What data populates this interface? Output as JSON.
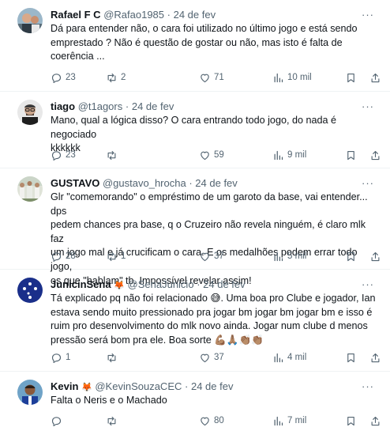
{
  "tweets": [
    {
      "name": "Rafael F C",
      "name_emoji": "",
      "handle": "@Rafao1985",
      "date": "24 de fev",
      "lines": [
        "Dá para entender não, o cara foi utilizado no último jogo e está sendo",
        "emprestado ? Não é questão de gostar ou não, mas isto é falta de",
        "coerência ..."
      ],
      "replies": "23",
      "retweets": "2",
      "likes": "71",
      "views": "10 mil"
    },
    {
      "name": "tiago",
      "name_emoji": "",
      "handle": "@t1agors",
      "date": "24 de fev",
      "lines": [
        "Mano, qual a lógica disso? O cara entrando todo jogo, do nada é negociado",
        "kkkkkk"
      ],
      "replies": "23",
      "retweets": "",
      "likes": "59",
      "views": "9 mil"
    },
    {
      "name": "GUSTAVO",
      "name_emoji": "",
      "handle": "@gustavo_hrocha",
      "date": "24 de fev",
      "lines": [
        "Glr \"comemorando\" o empréstimo de um garoto da base, vai entender... dps",
        "pedem chances pra base, q o Cruzeiro não revela ninguém, é claro mlk faz",
        "um jogo mal e já crucificam o cara. E os medalhões podem errar todo jogo,",
        "os que \"hablam\" tb. Impossível revelar assim!"
      ],
      "replies": "28",
      "retweets": "1",
      "likes": "37",
      "views": "5 mil"
    },
    {
      "name": "JunicinSena",
      "name_emoji": "🦊",
      "handle": "@SenaJunicio",
      "date": "24 de fev",
      "lines": [
        "Tá explicado pq não foi relacionado 😅. Uma boa pro Clube e jogador, Ian",
        "estava sendo muito pressionado pra jogar bm jogar bm jogar bm e isso é",
        "ruim pro desenvolvimento do mlk novo ainda. Jogar num clube d menos",
        "pressão será bom pra ele. Boa sorte 💪🏽🙏🏽👏🏽👏🏽"
      ],
      "replies": "1",
      "retweets": "",
      "likes": "37",
      "views": "4 mil"
    },
    {
      "name": "Kevin",
      "name_emoji": "🦊",
      "handle": "@KevinSouzaCEC",
      "date": "24 de fev",
      "lines": [
        "Falta o Neris e o Machado"
      ],
      "replies": "",
      "retweets": "",
      "likes": "80",
      "views": "7 mil"
    }
  ],
  "separator": "·",
  "more_glyph": "···",
  "icons": {
    "reply": "reply-icon",
    "retweet": "retweet-icon",
    "like": "heart-icon",
    "views": "views-chart-icon",
    "bookmark": "bookmark-icon",
    "share": "share-icon"
  },
  "colors": {
    "text": "#0f1419",
    "secondary": "#536471",
    "divider": "#eff3f4"
  }
}
